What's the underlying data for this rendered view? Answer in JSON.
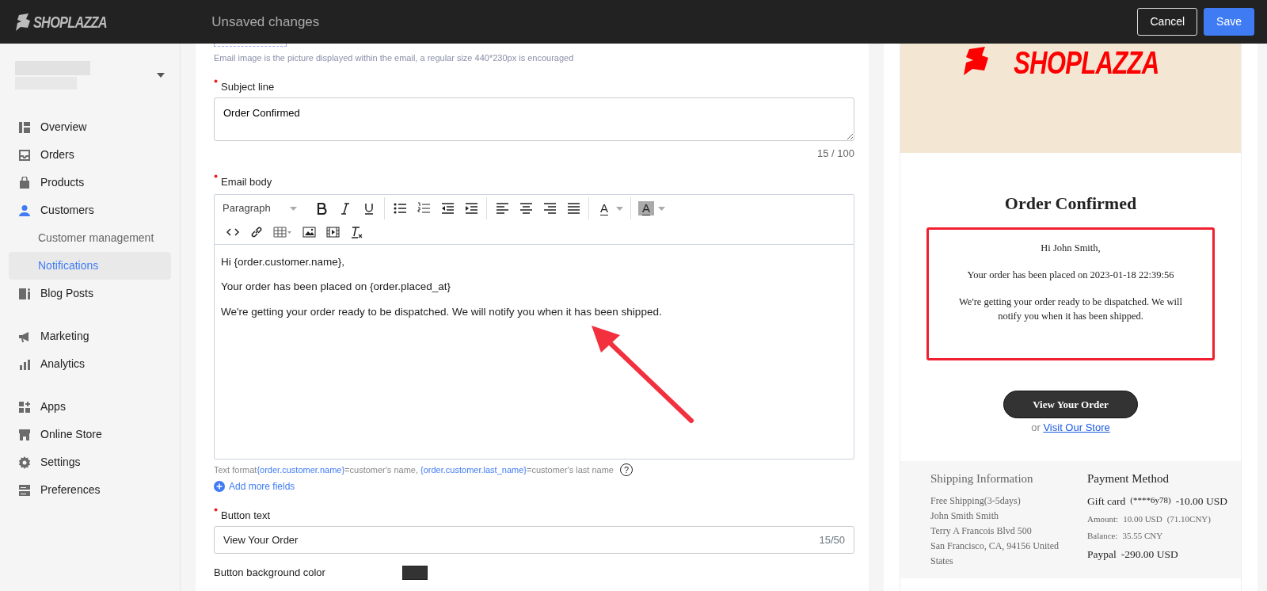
{
  "topbar": {
    "logo": "SHOPLAZZA",
    "title": "Unsaved changes",
    "buttons": [
      {
        "label": "Cancel",
        "kind": "secondary"
      },
      {
        "label": "Save",
        "kind": "primary"
      }
    ]
  },
  "sidebar": {
    "groups": [
      [
        {
          "label": "Overview",
          "selected": false
        },
        {
          "label": "Orders",
          "selected": false
        },
        {
          "label": "Products",
          "selected": false
        },
        {
          "label": "Customers",
          "selected": false,
          "children": [
            {
              "label": "Customer management",
              "selected": false
            },
            {
              "label": "Notifications",
              "selected": true
            }
          ]
        },
        {
          "label": "Blog Posts",
          "selected": false
        }
      ],
      [
        {
          "label": "Marketing",
          "selected": false
        },
        {
          "label": "Analytics",
          "selected": false
        }
      ],
      [
        {
          "label": "Apps",
          "selected": false
        },
        {
          "label": "Online Store",
          "selected": false
        },
        {
          "label": "Settings",
          "selected": false
        },
        {
          "label": "Preferences",
          "selected": false
        }
      ]
    ]
  },
  "form": {
    "image_hint": "Email image is the picture displayed within the email, a regular size 440*230px is encouraged",
    "subject": {
      "label": "Subject line",
      "required": true,
      "value": "Order Confirmed",
      "counter": "15 / 100"
    },
    "body": {
      "label": "Email body",
      "required": true,
      "format": "Paragraph",
      "toolbar": [
        [
          [
            {
              "kind": "bold"
            },
            {
              "kind": "italic"
            },
            {
              "kind": "underline"
            }
          ],
          [
            {
              "kind": "bullet-list"
            },
            {
              "kind": "numbered-list"
            },
            {
              "kind": "outdent"
            },
            {
              "kind": "indent"
            }
          ],
          [
            {
              "kind": "align-left"
            },
            {
              "kind": "align-center"
            },
            {
              "kind": "align-right"
            },
            {
              "kind": "justify"
            }
          ],
          [
            {
              "kind": "text-color",
              "glyph": "A"
            }
          ],
          [
            {
              "kind": "highlight",
              "glyph": "A"
            }
          ]
        ],
        [
          [
            {
              "kind": "code"
            },
            {
              "kind": "link"
            },
            {
              "kind": "table"
            },
            {
              "kind": "image"
            },
            {
              "kind": "video"
            },
            {
              "kind": "clear-format"
            }
          ]
        ]
      ],
      "paragraphs": [
        "Hi {order.customer.name},",
        "Your order has been placed on {order.placed_at}",
        "We're getting your order ready to be dispatched. We will notify you when it has been shipped."
      ]
    },
    "help": {
      "parts": [
        {
          "kind": "plain",
          "text": "Text format"
        },
        {
          "kind": "token",
          "text": "{order.customer.name}"
        },
        {
          "kind": "plain",
          "text": "=customer's name, "
        },
        {
          "kind": "token",
          "text": "{order.customer.last_name}"
        },
        {
          "kind": "plain",
          "text": "=customer's last name"
        }
      ],
      "glyph": "?"
    },
    "add_fields": "Add more fields",
    "button_text": {
      "label": "Button text",
      "required": true,
      "value": "View Your Order",
      "counter": "15/50"
    },
    "button_color": {
      "label": "Button background color",
      "color": "#333333"
    }
  },
  "annotation_arrow": true,
  "preview": {
    "logo": "SHOPLAZZA",
    "title": "Order Confirmed",
    "highlighted": true,
    "paragraphs": [
      "Hi John Smith,",
      "Your order has been placed on 2023-01-18 22:39:56",
      "We're getting your order ready to be dispatched. We will notify you when it has been shipped."
    ],
    "button": "View Your Order",
    "or": "or",
    "store_link": "Visit Our Store",
    "shipping": {
      "title": "Shipping Information",
      "lines": [
        "Free Shipping(3-5days)",
        "John Smith Smith",
        "Terry A Francois Blvd 500",
        "San Francisco, CA, 94156 United States"
      ]
    },
    "payment": {
      "title": "Payment Method",
      "lines": [
        {
          "kind": "main",
          "parts": [
            {
              "kind": "label",
              "text": "Gift card"
            },
            {
              "kind": "note",
              "text": "(****6y78)"
            },
            {
              "kind": "amount",
              "text": "-10.00 USD"
            }
          ]
        },
        {
          "kind": "sub",
          "parts": [
            {
              "kind": "label",
              "text": "Amount:"
            },
            {
              "kind": "amount",
              "text": "10.00 USD"
            },
            {
              "kind": "note",
              "text": "(71.10CNY)"
            }
          ]
        },
        {
          "kind": "sub",
          "parts": [
            {
              "kind": "label",
              "text": "Balance:"
            },
            {
              "kind": "amount",
              "text": "35.55 CNY"
            }
          ]
        },
        {
          "kind": "main",
          "parts": [
            {
              "kind": "label",
              "text": "Paypal"
            },
            {
              "kind": "amount",
              "text": "-290.00 USD"
            }
          ]
        }
      ]
    }
  }
}
